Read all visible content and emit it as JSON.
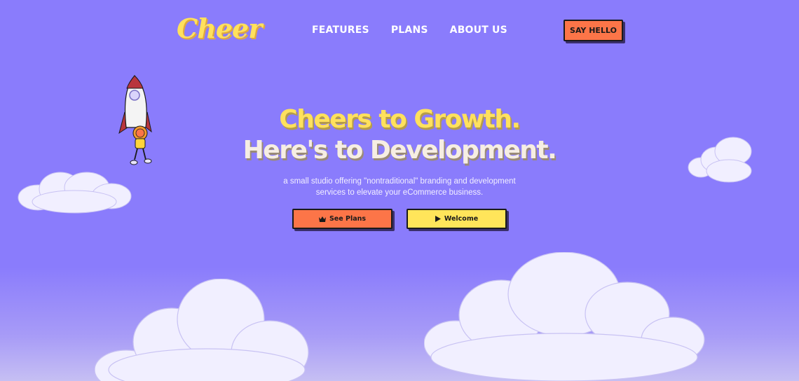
{
  "header": {
    "logo": "Cheer",
    "nav": [
      "FEATURES",
      "PLANS",
      "ABOUT US"
    ],
    "cta_label": "SAY HELLO"
  },
  "hero": {
    "title_line1": "Cheers to Growth.",
    "title_line2": "Here's to Development.",
    "subtitle_line1": "a small studio offering \"nontraditional\" branding and development",
    "subtitle_line2": "services to elevate your eCommerce business.",
    "primary_button": {
      "label": "See Plans",
      "icon": "crown-icon"
    },
    "secondary_button": {
      "label": "Welcome",
      "icon": "play-icon"
    }
  },
  "colors": {
    "background": "#8a7cfc",
    "accent_orange": "#fc7548",
    "accent_yellow": "#ffe15d",
    "cloud": "#f0eefe"
  }
}
